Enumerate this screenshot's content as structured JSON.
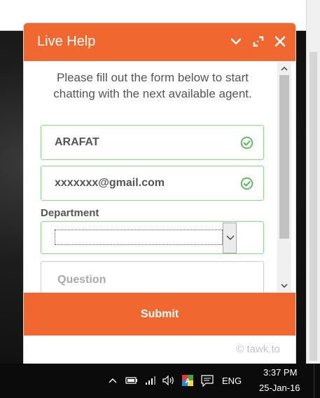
{
  "widget": {
    "title": "Live Help",
    "intro": "Please fill out the form below to start chatting with the next available agent.",
    "name_value": "ARAFAT",
    "email_value": "xxxxxxx@gmail.com",
    "department_label": "Department",
    "department_selected": "",
    "question_placeholder": "Question",
    "submit_label": "Submit",
    "brand": "© tawk.to"
  },
  "taskbar": {
    "language": "ENG",
    "time": "3:37 PM",
    "date": "25-Jan-16"
  },
  "colors": {
    "accent": "#f0682f",
    "valid_border": "#8fd48f",
    "valid_check": "#5cb85c"
  }
}
